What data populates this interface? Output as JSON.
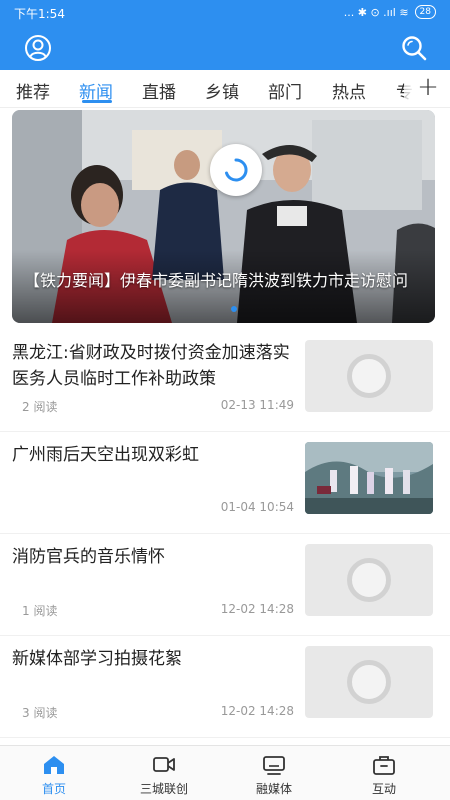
{
  "status_bar": {
    "time": "下午1:54",
    "indicators": "... ✱ ⊙ .ııl ≋",
    "battery": "28"
  },
  "header": {
    "user_icon": "user-circle-icon",
    "search_icon": "search-icon",
    "background_color": "#2d8ff0"
  },
  "tabs": {
    "items": [
      {
        "label": "推荐"
      },
      {
        "label": "新闻"
      },
      {
        "label": "直播"
      },
      {
        "label": "乡镇"
      },
      {
        "label": "部门"
      },
      {
        "label": "热点"
      },
      {
        "label": "专"
      }
    ],
    "active": "新闻",
    "add_icon": "plus-icon"
  },
  "banner": {
    "caption": "【铁力要闻】伊春市委副书记隋洪波到铁力市走访慰问",
    "loading_icon": "loading-spinner-icon"
  },
  "news": [
    {
      "title": "黑龙江:省财政及时拨付资金加速落实医务人员临时工作补助政策",
      "reads": "2 阅读",
      "date": "02-13 11:49",
      "thumb": "placeholder"
    },
    {
      "title": "广州雨后天空出现双彩虹",
      "reads": "",
      "date": "01-04 10:54",
      "thumb": "photo"
    },
    {
      "title": "消防官兵的音乐情怀",
      "reads": "1 阅读",
      "date": "12-02 14:28",
      "thumb": "placeholder"
    },
    {
      "title": "新媒体部学习拍摄花絮",
      "reads": "3 阅读",
      "date": "12-02 14:28",
      "thumb": "placeholder"
    }
  ],
  "tabbar": {
    "items": [
      {
        "label": "首页",
        "icon": "home-icon"
      },
      {
        "label": "三城联创",
        "icon": "video-icon"
      },
      {
        "label": "融媒体",
        "icon": "monitor-icon"
      },
      {
        "label": "互动",
        "icon": "briefcase-icon"
      }
    ],
    "active": "首页",
    "accent_color": "#2d8ff0"
  }
}
